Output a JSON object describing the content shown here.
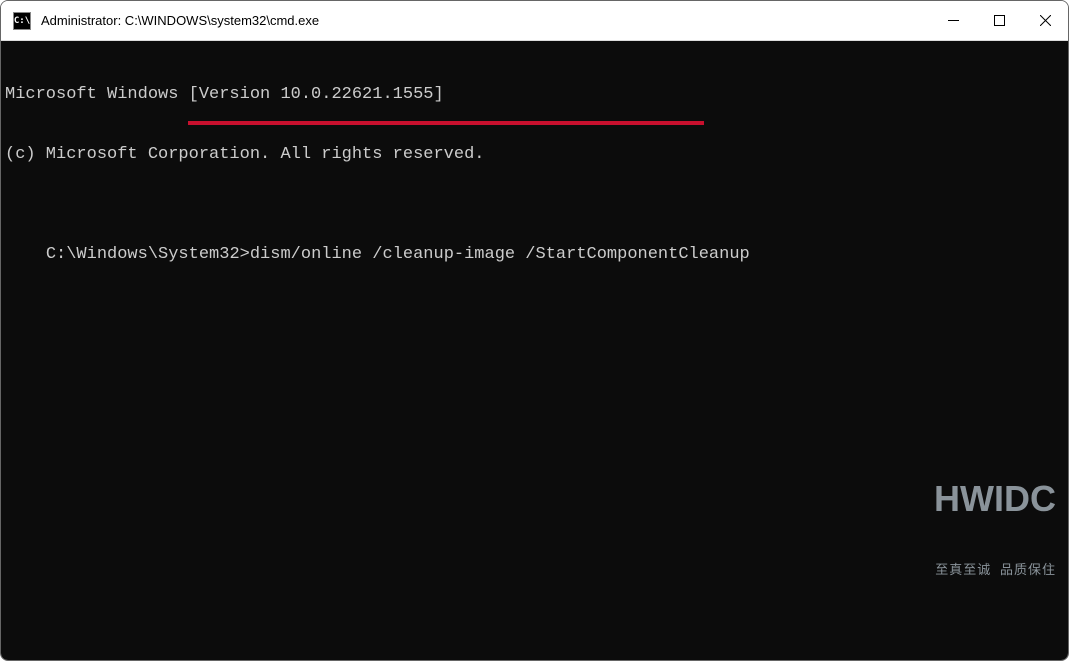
{
  "titlebar": {
    "icon_label": "C:\\",
    "title": "Administrator: C:\\WINDOWS\\system32\\cmd.exe"
  },
  "terminal": {
    "line1": "Microsoft Windows [Version 10.0.22621.1555]",
    "line2": "(c) Microsoft Corporation. All rights reserved.",
    "prompt": "C:\\Windows\\System32>",
    "command": "dism/online /cleanup-image /StartComponentCleanup"
  },
  "watermark": {
    "main": "HWIDC",
    "sub": "至真至诚 品质保住"
  }
}
